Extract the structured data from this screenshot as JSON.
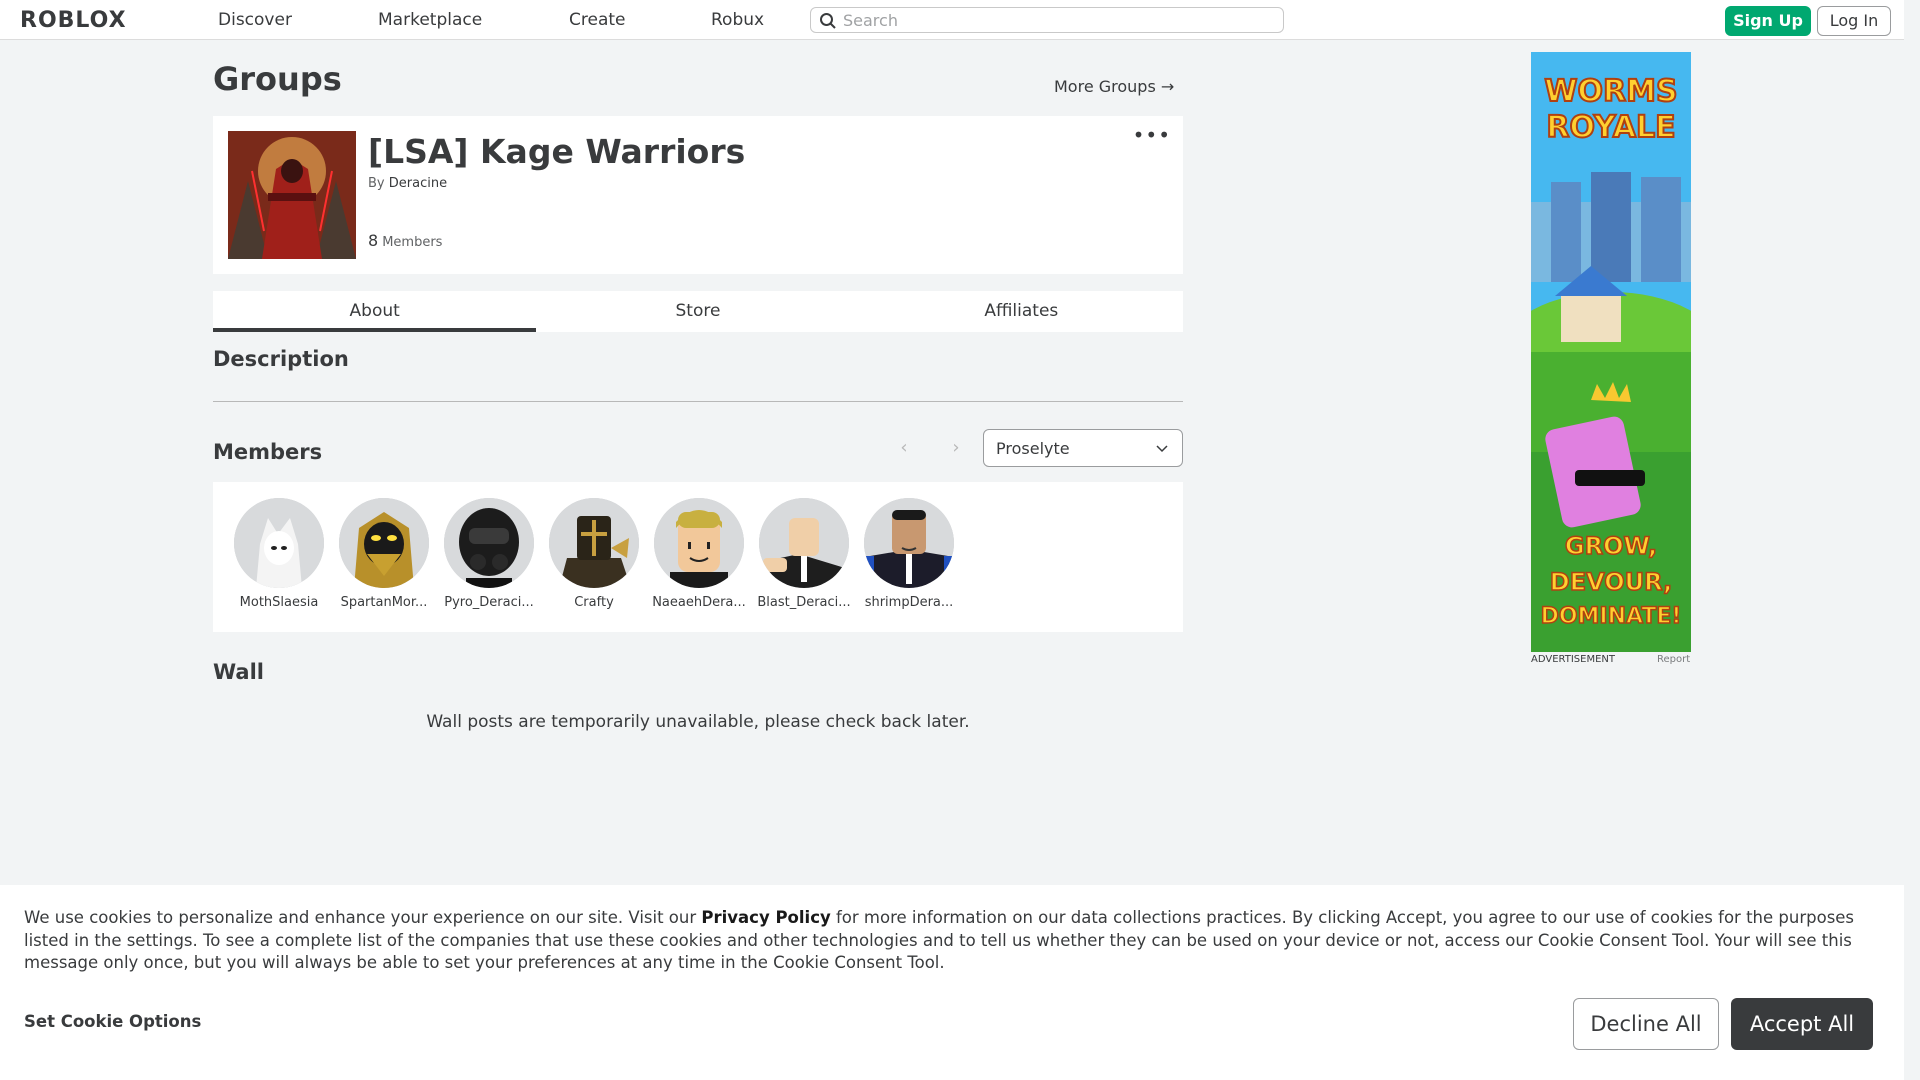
{
  "nav": {
    "logo": "ROBLOX",
    "links": [
      "Discover",
      "Marketplace",
      "Create",
      "Robux"
    ],
    "search_placeholder": "Search",
    "signup_label": "Sign Up",
    "login_label": "Log In"
  },
  "page": {
    "title": "Groups",
    "more_groups": "More Groups →"
  },
  "group": {
    "name": "[LSA] Kage Warriors",
    "by_label": "By",
    "owner": "Deracine",
    "member_count": "8",
    "members_label": "Members",
    "menu_glyph": "•••"
  },
  "tabs": [
    {
      "label": "About",
      "active": true
    },
    {
      "label": "Store",
      "active": false
    },
    {
      "label": "Affiliates",
      "active": false
    }
  ],
  "description": {
    "title": "Description"
  },
  "members_section": {
    "title": "Members",
    "prev_glyph": "‹",
    "next_glyph": "›",
    "role_selected": "Proselyte",
    "members": [
      {
        "name": "MothSlaesia"
      },
      {
        "name": "SpartanMor..."
      },
      {
        "name": "Pyro_Deraci..."
      },
      {
        "name": "Crafty"
      },
      {
        "name": "NaeaehDera..."
      },
      {
        "name": "Blast_Deraci..."
      },
      {
        "name": "shrimpDera..."
      }
    ]
  },
  "wall": {
    "title": "Wall",
    "message": "Wall posts are temporarily unavailable, please check back later."
  },
  "ad": {
    "label": "ADVERTISEMENT",
    "report": "Report",
    "headline_1": "WORMS",
    "headline_2": "ROYALE",
    "tagline_1": "GROW,",
    "tagline_2": "DEVOUR,",
    "tagline_3": "DOMINATE!"
  },
  "cookie": {
    "text_before": "We use cookies to personalize and enhance your experience on our site. Visit our ",
    "policy_link": "Privacy Policy",
    "text_after": " for more information on our data collections practices. By clicking Accept, you agree to our use of cookies for the purposes listed in the settings. To see a complete list of the companies that use these cookies and other technologies and to tell us whether they can be used on your device or not, access our Cookie Consent Tool. Your will see this message only once, but you will always be able to set your preferences at any time in the Cookie Consent Tool.",
    "options_label": "Set Cookie Options",
    "decline_label": "Decline All",
    "accept_label": "Accept All"
  },
  "colors": {
    "signup_green": "#00a870",
    "accept_dark": "#393b3d",
    "page_bg": "#f2f4f5"
  }
}
